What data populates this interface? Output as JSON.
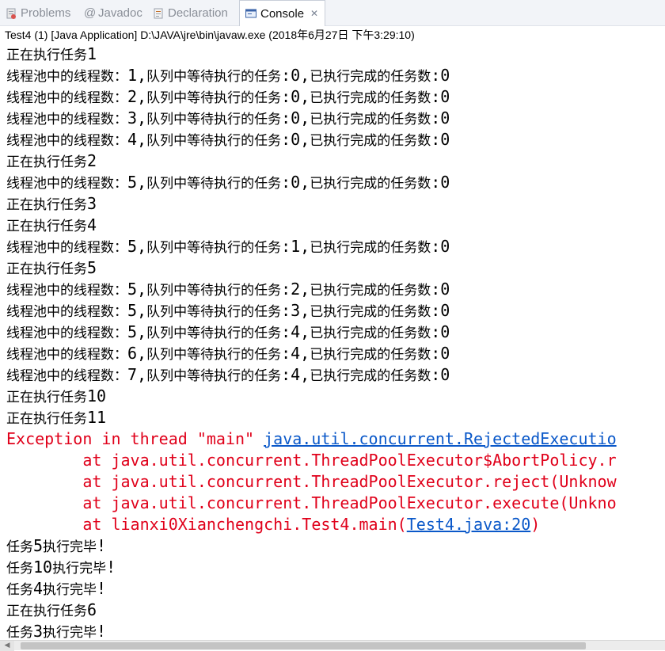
{
  "tabs": [
    {
      "label": "Problems",
      "icon": "problems-icon"
    },
    {
      "label": "Javadoc",
      "icon": "javadoc-icon"
    },
    {
      "label": "Declaration",
      "icon": "declaration-icon"
    },
    {
      "label": "Console",
      "icon": "console-icon",
      "active": true,
      "close": "✕"
    }
  ],
  "console_title": "Test4 (1) [Java Application] D:\\JAVA\\jre\\bin\\javaw.exe (2018年6月27日 下午3:29:10)",
  "colors": {
    "stderr": "#e0001a",
    "link": "#0a58c9",
    "stdout": "#000000"
  },
  "console_lines": [
    {
      "type": "out",
      "text": "正在执行任务1"
    },
    {
      "type": "out",
      "text": "线程池中的线程数：1,队列中等待执行的任务:0,已执行完成的任务数:0"
    },
    {
      "type": "out",
      "text": "线程池中的线程数：2,队列中等待执行的任务:0,已执行完成的任务数:0"
    },
    {
      "type": "out",
      "text": "线程池中的线程数：3,队列中等待执行的任务:0,已执行完成的任务数:0"
    },
    {
      "type": "out",
      "text": "线程池中的线程数：4,队列中等待执行的任务:0,已执行完成的任务数:0"
    },
    {
      "type": "out",
      "text": "正在执行任务2"
    },
    {
      "type": "out",
      "text": "线程池中的线程数：5,队列中等待执行的任务:0,已执行完成的任务数:0"
    },
    {
      "type": "out",
      "text": "正在执行任务3"
    },
    {
      "type": "out",
      "text": "正在执行任务4"
    },
    {
      "type": "out",
      "text": "线程池中的线程数：5,队列中等待执行的任务:1,已执行完成的任务数:0"
    },
    {
      "type": "out",
      "text": "正在执行任务5"
    },
    {
      "type": "out",
      "text": "线程池中的线程数：5,队列中等待执行的任务:2,已执行完成的任务数:0"
    },
    {
      "type": "out",
      "text": "线程池中的线程数：5,队列中等待执行的任务:3,已执行完成的任务数:0"
    },
    {
      "type": "out",
      "text": "线程池中的线程数：5,队列中等待执行的任务:4,已执行完成的任务数:0"
    },
    {
      "type": "out",
      "text": "线程池中的线程数：6,队列中等待执行的任务:4,已执行完成的任务数:0"
    },
    {
      "type": "out",
      "text": "线程池中的线程数：7,队列中等待执行的任务:4,已执行完成的任务数:0"
    },
    {
      "type": "out",
      "text": "正在执行任务10"
    },
    {
      "type": "out",
      "text": "正在执行任务11"
    },
    {
      "type": "err",
      "text": "Exception in thread \"main\" ",
      "link": "java.util.concurrent.RejectedExecutio"
    },
    {
      "type": "err",
      "text": "        at java.util.concurrent.ThreadPoolExecutor$AbortPolicy.r"
    },
    {
      "type": "err",
      "text": "        at java.util.concurrent.ThreadPoolExecutor.reject(Unknow"
    },
    {
      "type": "err",
      "text": "        at java.util.concurrent.ThreadPoolExecutor.execute(Unkno"
    },
    {
      "type": "err",
      "text": "        at lianxi0Xianchengchi.Test4.main(",
      "link": "Test4.java:20",
      "after": ")"
    },
    {
      "type": "out",
      "text": "任务5执行完毕!"
    },
    {
      "type": "out",
      "text": "任务10执行完毕!"
    },
    {
      "type": "out",
      "text": "任务4执行完毕!"
    },
    {
      "type": "out",
      "text": "正在执行任务6"
    },
    {
      "type": "out",
      "text": "任务3执行完毕!"
    }
  ]
}
